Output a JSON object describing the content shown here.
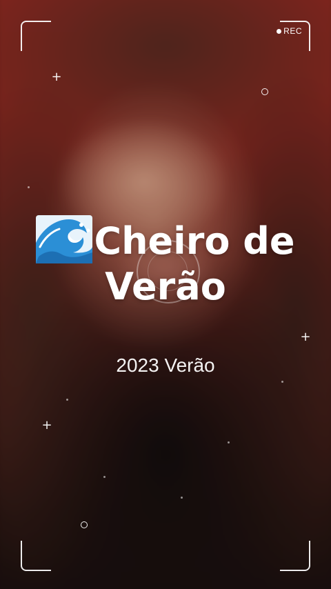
{
  "recorder": {
    "rec_label": "REC"
  },
  "overlay": {
    "title_line1": "Cheiro de",
    "title_line2": "Verão",
    "title_emoji_icon": "water-wave-icon",
    "subtitle": "2023 Verão"
  },
  "colors": {
    "overlay_white": "#ffffff",
    "backdrop_red": "#9a2d24",
    "wave_blue": "#2b8fd6"
  }
}
